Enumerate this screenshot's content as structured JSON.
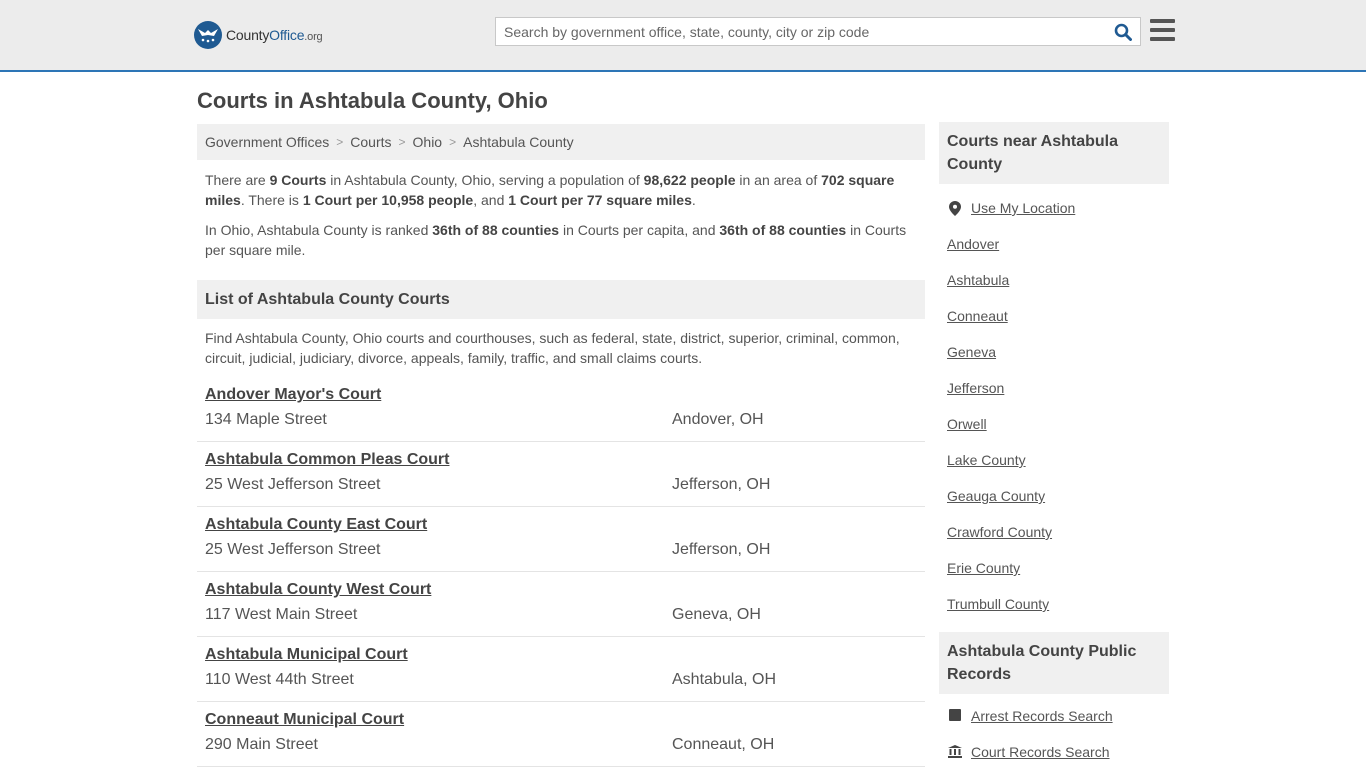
{
  "header": {
    "logo": {
      "part1": "County",
      "part2": "Office",
      "part3": ".org"
    },
    "search": {
      "placeholder": "Search by government office, state, county, city or zip code",
      "value": ""
    }
  },
  "page_title": "Courts in Ashtabula County, Ohio",
  "breadcrumb": [
    "Government Offices",
    "Courts",
    "Ohio",
    "Ashtabula County"
  ],
  "summary": {
    "p1": {
      "t1": "There are ",
      "courts_count": "9 Courts",
      "t2": " in Ashtabula County, Ohio, serving a population of ",
      "population": "98,622 people",
      "t3": " in an area of ",
      "area": "702 square miles",
      "t4": ". There is ",
      "per_people": "1 Court per 10,958 people",
      "t5": ", and ",
      "per_area": "1 Court per 77 square miles",
      "t6": "."
    },
    "p2": {
      "t1": "In Ohio, Ashtabula County is ranked ",
      "rank1": "36th of 88 counties",
      "t2": " in Courts per capita, and ",
      "rank2": "36th of 88 counties",
      "t3": " in Courts per square mile."
    }
  },
  "list_section": {
    "title": "List of Ashtabula County Courts",
    "description": "Find Ashtabula County, Ohio courts and courthouses, such as federal, state, district, superior, criminal, common, circuit, judicial, judiciary, divorce, appeals, family, traffic, and small claims courts."
  },
  "courts": [
    {
      "name": "Andover Mayor's Court",
      "address": "134 Maple Street",
      "city": "Andover, OH"
    },
    {
      "name": "Ashtabula Common Pleas Court",
      "address": "25 West Jefferson Street",
      "city": "Jefferson, OH"
    },
    {
      "name": "Ashtabula County East Court",
      "address": "25 West Jefferson Street",
      "city": "Jefferson, OH"
    },
    {
      "name": "Ashtabula County West Court",
      "address": "117 West Main Street",
      "city": "Geneva, OH"
    },
    {
      "name": "Ashtabula Municipal Court",
      "address": "110 West 44th Street",
      "city": "Ashtabula, OH"
    },
    {
      "name": "Conneaut Municipal Court",
      "address": "290 Main Street",
      "city": "Conneaut, OH"
    }
  ],
  "sidebar": {
    "nearby_title": "Courts near Ashtabula County",
    "use_location": "Use My Location",
    "nearby": [
      "Andover",
      "Ashtabula",
      "Conneaut",
      "Geneva",
      "Jefferson",
      "Orwell",
      "Lake County",
      "Geauga County",
      "Crawford County",
      "Erie County",
      "Trumbull County"
    ],
    "records_title": "Ashtabula County Public Records",
    "records": [
      {
        "label": "Arrest Records Search",
        "icon": "square-icon"
      },
      {
        "label": "Court Records Search",
        "icon": "courthouse-icon"
      }
    ]
  },
  "colors": {
    "brand_blue": "#1f5a92",
    "header_bg": "#ececec",
    "header_border": "#2d75b6",
    "panel_bg": "#f0f0f0"
  }
}
